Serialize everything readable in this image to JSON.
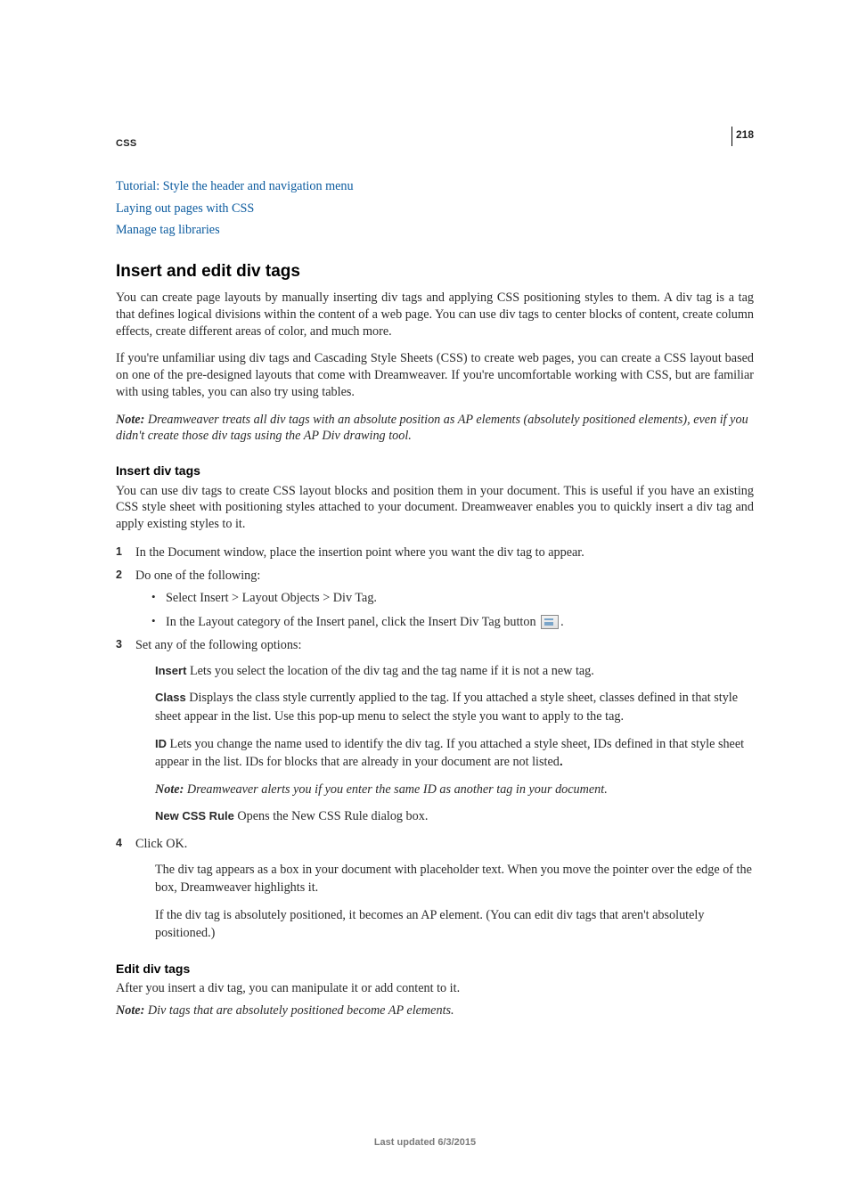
{
  "chapter": "CSS",
  "page_number": "218",
  "links": [
    "Tutorial: Style the header and navigation menu",
    "Laying out pages with CSS",
    "Manage tag libraries"
  ],
  "h_insert_edit": "Insert and edit div tags",
  "p1": "You can create page layouts by manually inserting div tags and applying CSS positioning styles to them. A div tag is a tag that defines logical divisions within the content of a web page. You can use div tags to center blocks of content, create column effects, create different areas of color, and much more.",
  "p2": "If you're unfamiliar using div tags and Cascading Style Sheets (CSS) to create web pages, you can create a CSS layout based on one of the pre-designed layouts that come with Dreamweaver. If you're uncomfortable working with CSS, but are familiar with using tables, you can also try using tables.",
  "note1_lead": "Note:",
  "note1_txt": " Dreamweaver treats all div tags with an absolute position as AP elements (absolutely positioned elements), even if you didn't create those div tags using the AP Div drawing tool.",
  "h_insert": "Insert div tags",
  "p3": "You can use div tags to create CSS layout blocks and position them in your document. This is useful if you have an existing CSS style sheet with positioning styles attached to your document. Dreamweaver enables you to quickly insert a div tag and apply existing styles to it.",
  "step1": "In the Document window, place the insertion point where you want the div tag to appear.",
  "step2": "Do one of the following:",
  "step2_b1": "Select Insert > Layout Objects > Div Tag.",
  "step2_b2a": "In the Layout category of the Insert panel, click the Insert Div Tag button ",
  "step2_b2b": ".",
  "step3": "Set any of the following options:",
  "opt_insert_lbl": "Insert",
  "opt_insert_txt": "  Lets you select the location of the div tag and the tag name if it is not a new tag.",
  "opt_class_lbl": "Class",
  "opt_class_txt": "  Displays the class style currently applied to the tag. If you attached a style sheet, classes defined in that style sheet appear in the list. Use this pop-up menu to select the style you want to apply to the tag.",
  "opt_id_lbl": "ID",
  "opt_id_txt": "  Lets you change the name used to identify the div tag. If you attached a style sheet, IDs defined in that style sheet appear in the list. IDs for blocks that are already in your document are not listed",
  "opt_id_dot": ".",
  "note2_lead": "Note:",
  "note2_txt": " Dreamweaver alerts you if you enter the same ID as another tag in your document.",
  "opt_ncr_lbl": "New CSS Rule",
  "opt_ncr_txt": "  Opens the New CSS Rule dialog box.",
  "step4": "Click OK.",
  "step4_p1": "The div tag appears as a box in your document with placeholder text. When you move the pointer over the edge of the box, Dreamweaver highlights it.",
  "step4_p2": "If the div tag is absolutely positioned, it becomes an AP element. (You can edit div tags that aren't absolutely positioned.)",
  "h_edit": "Edit div tags",
  "p_edit1": "After you insert a div tag, you can manipulate it or add content to it.",
  "note3_lead": "Note:",
  "note3_txt": " Div tags that are absolutely positioned become AP elements.",
  "footer": "Last updated 6/3/2015"
}
